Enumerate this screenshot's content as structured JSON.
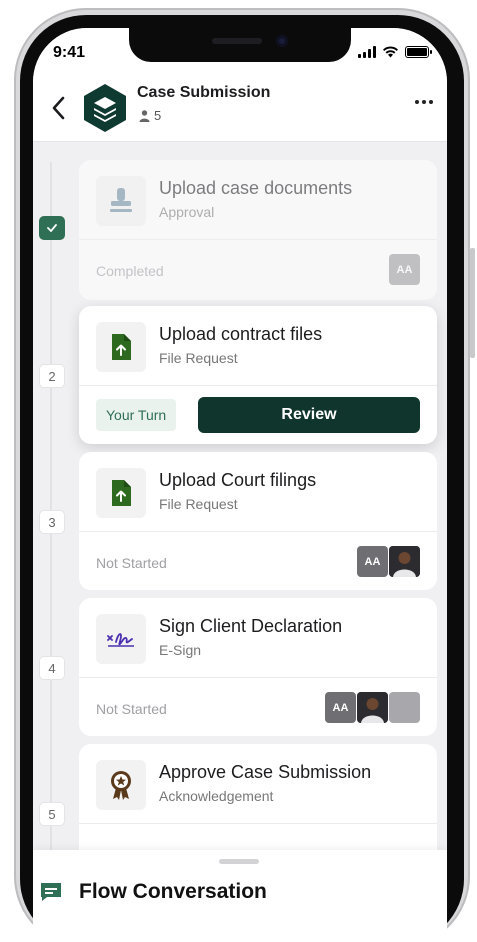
{
  "status_bar": {
    "time": "9:41"
  },
  "header": {
    "title": "Case Submission",
    "member_count": "5"
  },
  "steps": [
    {
      "marker": "",
      "title": "Upload case documents",
      "subtitle": "Approval",
      "status": "Completed",
      "avatars": [
        "AA"
      ]
    },
    {
      "marker": "2",
      "title": "Upload contract files",
      "subtitle": "File Request",
      "your_turn": "Your Turn",
      "action": "Review"
    },
    {
      "marker": "3",
      "title": "Upload Court filings",
      "subtitle": "File Request",
      "status": "Not Started",
      "avatars": [
        "AA"
      ]
    },
    {
      "marker": "4",
      "title": "Sign Client Declaration",
      "subtitle": "E-Sign",
      "status": "Not Started",
      "avatars": [
        "AA"
      ]
    },
    {
      "marker": "5",
      "title": "Approve Case Submission",
      "subtitle": "Acknowledgement"
    }
  ],
  "bottom_sheet": {
    "title": "Flow Conversation"
  },
  "colors": {
    "accent": "#2f6f55",
    "primary_button": "#10352c",
    "file_icon": "#2d6a1f",
    "esign_icon": "#4b2fb0",
    "award_icon": "#5a3a1a"
  },
  "icons": {
    "back": "chevron-left-icon",
    "logo": "layers-icon",
    "members": "person-icon",
    "more": "more-horizontal-icon",
    "approval": "stamp-icon",
    "file": "file-upload-icon",
    "esign": "signature-icon",
    "acknowledge": "award-icon",
    "conversation": "chat-icon",
    "completed": "check-icon"
  }
}
